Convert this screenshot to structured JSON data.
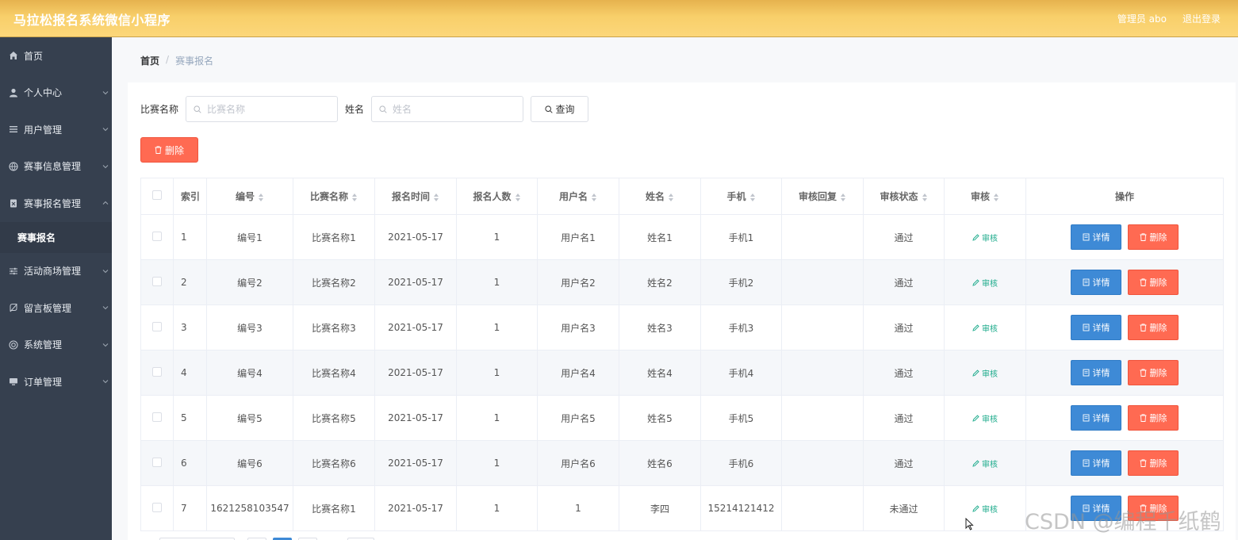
{
  "app": {
    "title": "马拉松报名系统微信小程序",
    "admin_label": "管理员 abo",
    "logout_label": "退出登录"
  },
  "sidebar": {
    "items": [
      {
        "label": "首页",
        "icon": "home-icon"
      },
      {
        "label": "个人中心",
        "icon": "user-icon"
      },
      {
        "label": "用户管理",
        "icon": "list-icon"
      },
      {
        "label": "赛事信息管理",
        "icon": "globe-icon"
      },
      {
        "label": "赛事报名管理",
        "icon": "clipboard-icon"
      },
      {
        "label": "赛事报名",
        "icon": ""
      },
      {
        "label": "活动商场管理",
        "icon": "sliders-icon"
      },
      {
        "label": "留言板管理",
        "icon": "message-icon"
      },
      {
        "label": "系统管理",
        "icon": "settings-icon"
      },
      {
        "label": "订单管理",
        "icon": "monitor-icon"
      }
    ]
  },
  "breadcrumb": {
    "home": "首页",
    "separator": "/",
    "current": "赛事报名"
  },
  "search": {
    "field1_label": "比赛名称",
    "field1_placeholder": "比赛名称",
    "field2_label": "姓名",
    "field2_placeholder": "姓名",
    "query_label": "查询"
  },
  "toolbar": {
    "delete_label": "删除"
  },
  "table": {
    "columns": [
      "索引",
      "编号",
      "比赛名称",
      "报名时间",
      "报名人数",
      "用户名",
      "姓名",
      "手机",
      "审核回复",
      "审核状态",
      "审核",
      "操作"
    ],
    "rows": [
      {
        "index": "1",
        "code": "编号1",
        "match": "比赛名称1",
        "time": "2021-05-17",
        "count": "1",
        "username": "用户名1",
        "name": "姓名1",
        "phone": "手机1",
        "reply": "",
        "status": "通过"
      },
      {
        "index": "2",
        "code": "编号2",
        "match": "比赛名称2",
        "time": "2021-05-17",
        "count": "1",
        "username": "用户名2",
        "name": "姓名2",
        "phone": "手机2",
        "reply": "",
        "status": "通过"
      },
      {
        "index": "3",
        "code": "编号3",
        "match": "比赛名称3",
        "time": "2021-05-17",
        "count": "1",
        "username": "用户名3",
        "name": "姓名3",
        "phone": "手机3",
        "reply": "",
        "status": "通过"
      },
      {
        "index": "4",
        "code": "编号4",
        "match": "比赛名称4",
        "time": "2021-05-17",
        "count": "1",
        "username": "用户名4",
        "name": "姓名4",
        "phone": "手机4",
        "reply": "",
        "status": "通过"
      },
      {
        "index": "5",
        "code": "编号5",
        "match": "比赛名称5",
        "time": "2021-05-17",
        "count": "1",
        "username": "用户名5",
        "name": "姓名5",
        "phone": "手机5",
        "reply": "",
        "status": "通过"
      },
      {
        "index": "6",
        "code": "编号6",
        "match": "比赛名称6",
        "time": "2021-05-17",
        "count": "1",
        "username": "用户名6",
        "name": "姓名6",
        "phone": "手机6",
        "reply": "",
        "status": "通过"
      },
      {
        "index": "7",
        "code": "1621258103547",
        "match": "比赛名称1",
        "time": "2021-05-17",
        "count": "1",
        "username": "1",
        "name": "李四",
        "phone": "15214121412",
        "reply": "",
        "status": "未通过"
      }
    ],
    "audit_label": "审核",
    "detail_label": "详情",
    "delete_label": "删除"
  },
  "watermark": "CSDN @编程千纸鹤",
  "colors": {
    "topbar": "#fcd77a",
    "sidebar": "#36404f",
    "primary": "#3e8ad6",
    "danger": "#ff6a52",
    "success_link": "#1aaa8a"
  }
}
